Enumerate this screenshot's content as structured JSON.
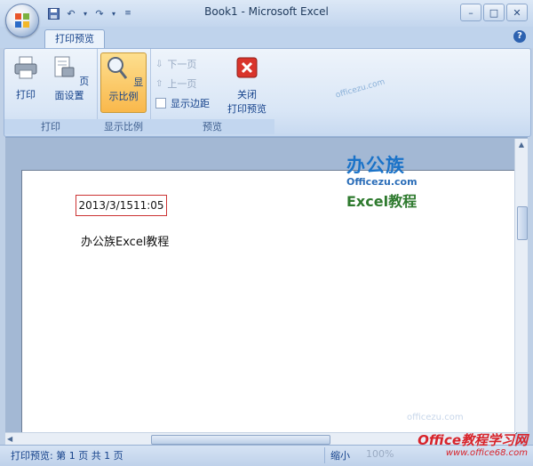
{
  "window": {
    "title": "Book1 - Microsoft Excel",
    "controls": {
      "minimize": "–",
      "maximize": "□",
      "close": "✕"
    }
  },
  "quick_access": {
    "icons": [
      "save-icon",
      "undo-icon",
      "redo-icon",
      "customize-icon"
    ]
  },
  "tabs": [
    {
      "label": "打印预览",
      "active": true
    }
  ],
  "ribbon": {
    "groups": [
      {
        "label": "打印",
        "buttons": [
          {
            "label": "打印",
            "icon": "printer-icon"
          },
          {
            "label": "页面设置",
            "icon": "page-setup-icon"
          }
        ]
      },
      {
        "label": "显示比例",
        "buttons": [
          {
            "label": "显示比例",
            "icon": "magnifier-icon",
            "active": true
          }
        ]
      },
      {
        "label": "预览",
        "small": [
          {
            "label": "下一页",
            "disabled": true
          },
          {
            "label": "上一页",
            "disabled": true
          },
          {
            "label": "显示边距",
            "checkbox": true
          }
        ],
        "close": {
          "label_line1": "关闭",
          "label_line2": "打印预览",
          "icon": "close-preview-icon"
        }
      }
    ]
  },
  "page": {
    "date_cell": "2013/3/1511:05",
    "text": "办公族Excel教程"
  },
  "watermark": {
    "logo_cn": "办公族",
    "logo_en": "Officezu.com",
    "logo_sub": "Excel教程",
    "side": "officezu.com",
    "bottom_faint": "officezu.com",
    "bottom_title": "Office教程学习网",
    "bottom_url": "www.office68.com"
  },
  "status": {
    "left": "打印预览: 第 1 页 共 1 页",
    "zoom_out": "缩小",
    "zoom_level": "100%"
  },
  "colors": {
    "accent": "#15428b",
    "active_button": "#f9b84b",
    "date_border": "#cc3333"
  }
}
